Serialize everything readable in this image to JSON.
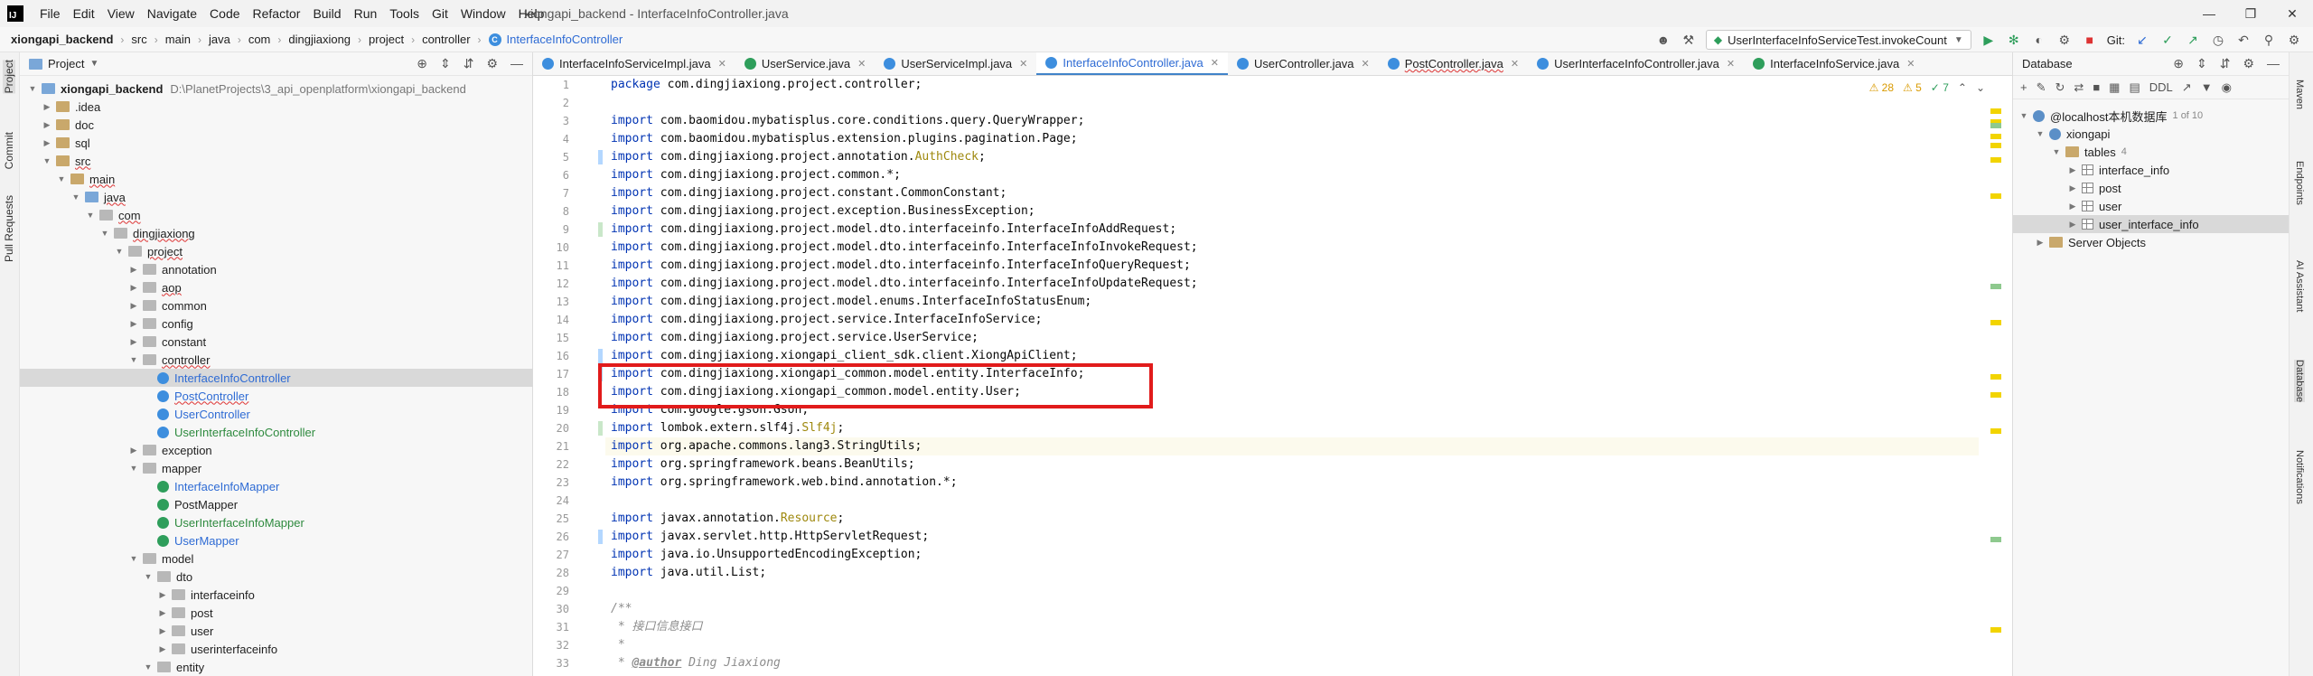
{
  "menubar": {
    "items": [
      "File",
      "Edit",
      "View",
      "Navigate",
      "Code",
      "Refactor",
      "Build",
      "Run",
      "Tools",
      "Git",
      "Window",
      "Help"
    ],
    "window_title": "xiongapi_backend - InterfaceInfoController.java"
  },
  "nav": {
    "crumbs": [
      "xiongapi_backend",
      "src",
      "main",
      "java",
      "com",
      "dingjiaxiong",
      "project",
      "controller"
    ],
    "current_file": "InterfaceInfoController",
    "run_config": "UserInterfaceInfoServiceTest.invokeCount",
    "git_label": "Git:"
  },
  "left_strip": [
    "Project",
    "Commit",
    "Pull Requests"
  ],
  "project_panel": {
    "title": "Project",
    "root_path": "D:\\PlanetProjects\\3_api_openplatform\\xiongapi_backend",
    "tree": [
      {
        "label": "xiongapi_backend",
        "depth": 0,
        "kind": "module",
        "open": true,
        "bold": true
      },
      {
        "label": ".idea",
        "depth": 1,
        "kind": "folder",
        "open": false
      },
      {
        "label": "doc",
        "depth": 1,
        "kind": "folder",
        "open": false
      },
      {
        "label": "sql",
        "depth": 1,
        "kind": "folder",
        "open": false
      },
      {
        "label": "src",
        "depth": 1,
        "kind": "folder",
        "open": true,
        "err": true
      },
      {
        "label": "main",
        "depth": 2,
        "kind": "folder",
        "open": true,
        "err": true
      },
      {
        "label": "java",
        "depth": 3,
        "kind": "src",
        "open": true,
        "err": true
      },
      {
        "label": "com",
        "depth": 4,
        "kind": "pkg",
        "open": true,
        "err": true
      },
      {
        "label": "dingjiaxiong",
        "depth": 5,
        "kind": "pkg",
        "open": true,
        "err": true
      },
      {
        "label": "project",
        "depth": 6,
        "kind": "pkg",
        "open": true,
        "err": true
      },
      {
        "label": "annotation",
        "depth": 7,
        "kind": "pkg",
        "open": false
      },
      {
        "label": "aop",
        "depth": 7,
        "kind": "pkg",
        "open": false,
        "err": true
      },
      {
        "label": "common",
        "depth": 7,
        "kind": "pkg",
        "open": false
      },
      {
        "label": "config",
        "depth": 7,
        "kind": "pkg",
        "open": false
      },
      {
        "label": "constant",
        "depth": 7,
        "kind": "pkg",
        "open": false
      },
      {
        "label": "controller",
        "depth": 7,
        "kind": "pkg",
        "open": true,
        "err": true
      },
      {
        "label": "InterfaceInfoController",
        "depth": 8,
        "kind": "class",
        "color": "blue",
        "selected": true
      },
      {
        "label": "PostController",
        "depth": 8,
        "kind": "class",
        "color": "blue",
        "err": true
      },
      {
        "label": "UserController",
        "depth": 8,
        "kind": "class",
        "color": "blue"
      },
      {
        "label": "UserInterfaceInfoController",
        "depth": 8,
        "kind": "class",
        "color": "green"
      },
      {
        "label": "exception",
        "depth": 7,
        "kind": "pkg",
        "open": false
      },
      {
        "label": "mapper",
        "depth": 7,
        "kind": "pkg",
        "open": true
      },
      {
        "label": "InterfaceInfoMapper",
        "depth": 8,
        "kind": "iface",
        "color": "blue"
      },
      {
        "label": "PostMapper",
        "depth": 8,
        "kind": "iface",
        "color": ""
      },
      {
        "label": "UserInterfaceInfoMapper",
        "depth": 8,
        "kind": "iface",
        "color": "green"
      },
      {
        "label": "UserMapper",
        "depth": 8,
        "kind": "iface",
        "color": "blue"
      },
      {
        "label": "model",
        "depth": 7,
        "kind": "pkg",
        "open": true
      },
      {
        "label": "dto",
        "depth": 8,
        "kind": "pkg",
        "open": true
      },
      {
        "label": "interfaceinfo",
        "depth": 9,
        "kind": "pkg",
        "open": false
      },
      {
        "label": "post",
        "depth": 9,
        "kind": "pkg",
        "open": false
      },
      {
        "label": "user",
        "depth": 9,
        "kind": "pkg",
        "open": false
      },
      {
        "label": "userinterfaceinfo",
        "depth": 9,
        "kind": "pkg",
        "open": false
      },
      {
        "label": "entity",
        "depth": 8,
        "kind": "pkg",
        "open": true
      }
    ]
  },
  "editor_tabs": [
    {
      "label": "InterfaceInfoServiceImpl.java",
      "icon": "c"
    },
    {
      "label": "UserService.java",
      "icon": "i"
    },
    {
      "label": "UserServiceImpl.java",
      "icon": "c"
    },
    {
      "label": "InterfaceInfoController.java",
      "icon": "c",
      "active": true
    },
    {
      "label": "UserController.java",
      "icon": "c"
    },
    {
      "label": "PostController.java",
      "icon": "c",
      "ul": true
    },
    {
      "label": "UserInterfaceInfoController.java",
      "icon": "c"
    },
    {
      "label": "InterfaceInfoService.java",
      "icon": "i"
    }
  ],
  "inspections": {
    "warnings": "28",
    "weak": "5",
    "typos": "7"
  },
  "code_lines": [
    {
      "n": "1",
      "t": "package com.dingjiaxiong.project.controller;"
    },
    {
      "n": "2",
      "t": ""
    },
    {
      "n": "3",
      "t": "import com.baomidou.mybatisplus.core.conditions.query.QueryWrapper;"
    },
    {
      "n": "4",
      "t": "import com.baomidou.mybatisplus.extension.plugins.pagination.Page;"
    },
    {
      "n": "5",
      "t": "import com.dingjiaxiong.project.annotation.AuthCheck;"
    },
    {
      "n": "6",
      "t": "import com.dingjiaxiong.project.common.*;"
    },
    {
      "n": "7",
      "t": "import com.dingjiaxiong.project.constant.CommonConstant;"
    },
    {
      "n": "8",
      "t": "import com.dingjiaxiong.project.exception.BusinessException;"
    },
    {
      "n": "9",
      "t": "import com.dingjiaxiong.project.model.dto.interfaceinfo.InterfaceInfoAddRequest;"
    },
    {
      "n": "10",
      "t": "import com.dingjiaxiong.project.model.dto.interfaceinfo.InterfaceInfoInvokeRequest;"
    },
    {
      "n": "11",
      "t": "import com.dingjiaxiong.project.model.dto.interfaceinfo.InterfaceInfoQueryRequest;"
    },
    {
      "n": "12",
      "t": "import com.dingjiaxiong.project.model.dto.interfaceinfo.InterfaceInfoUpdateRequest;"
    },
    {
      "n": "13",
      "t": "import com.dingjiaxiong.project.model.enums.InterfaceInfoStatusEnum;"
    },
    {
      "n": "14",
      "t": "import com.dingjiaxiong.project.service.InterfaceInfoService;"
    },
    {
      "n": "15",
      "t": "import com.dingjiaxiong.project.service.UserService;"
    },
    {
      "n": "16",
      "t": "import com.dingjiaxiong.xiongapi_client_sdk.client.XiongApiClient;"
    },
    {
      "n": "17",
      "t": "import com.dingjiaxiong.xiongapi_common.model.entity.InterfaceInfo;"
    },
    {
      "n": "18",
      "t": "import com.dingjiaxiong.xiongapi_common.model.entity.User;"
    },
    {
      "n": "19",
      "t": "import com.google.gson.Gson;"
    },
    {
      "n": "20",
      "t": "import lombok.extern.slf4j.Slf4j;"
    },
    {
      "n": "21",
      "t": "import org.apache.commons.lang3.StringUtils;"
    },
    {
      "n": "22",
      "t": "import org.springframework.beans.BeanUtils;"
    },
    {
      "n": "23",
      "t": "import org.springframework.web.bind.annotation.*;"
    },
    {
      "n": "24",
      "t": ""
    },
    {
      "n": "25",
      "t": "import javax.annotation.Resource;"
    },
    {
      "n": "26",
      "t": "import javax.servlet.http.HttpServletRequest;"
    },
    {
      "n": "27",
      "t": "import java.io.UnsupportedEncodingException;"
    },
    {
      "n": "28",
      "t": "import java.util.List;"
    },
    {
      "n": "29",
      "t": ""
    },
    {
      "n": "30",
      "t": "/**"
    },
    {
      "n": "31",
      "t": " * 接口信息接口"
    },
    {
      "n": "32",
      "t": " *"
    },
    {
      "n": "33",
      "t": " * @author Ding Jiaxiong"
    }
  ],
  "db_panel": {
    "title": "Database",
    "ddl_label": "DDL",
    "rows": [
      {
        "label": "@localhost本机数据库",
        "depth": 0,
        "kind": "db",
        "open": true,
        "count": "1 of 10"
      },
      {
        "label": "xiongapi",
        "depth": 1,
        "kind": "db",
        "open": true
      },
      {
        "label": "tables",
        "depth": 2,
        "kind": "folder",
        "open": true,
        "count": "4"
      },
      {
        "label": "interface_info",
        "depth": 3,
        "kind": "table",
        "open": false
      },
      {
        "label": "post",
        "depth": 3,
        "kind": "table",
        "open": false
      },
      {
        "label": "user",
        "depth": 3,
        "kind": "table",
        "open": false
      },
      {
        "label": "user_interface_info",
        "depth": 3,
        "kind": "table",
        "open": false,
        "selected": true
      },
      {
        "label": "Server Objects",
        "depth": 1,
        "kind": "folder",
        "open": false
      }
    ]
  },
  "right_strip": [
    "Maven",
    "Endpoints",
    "AI Assistant",
    "Database",
    "Notifications"
  ],
  "colors": {
    "accent": "#4083c9",
    "highlight_box": "#e11b1b",
    "keyword": "#0033b3"
  }
}
